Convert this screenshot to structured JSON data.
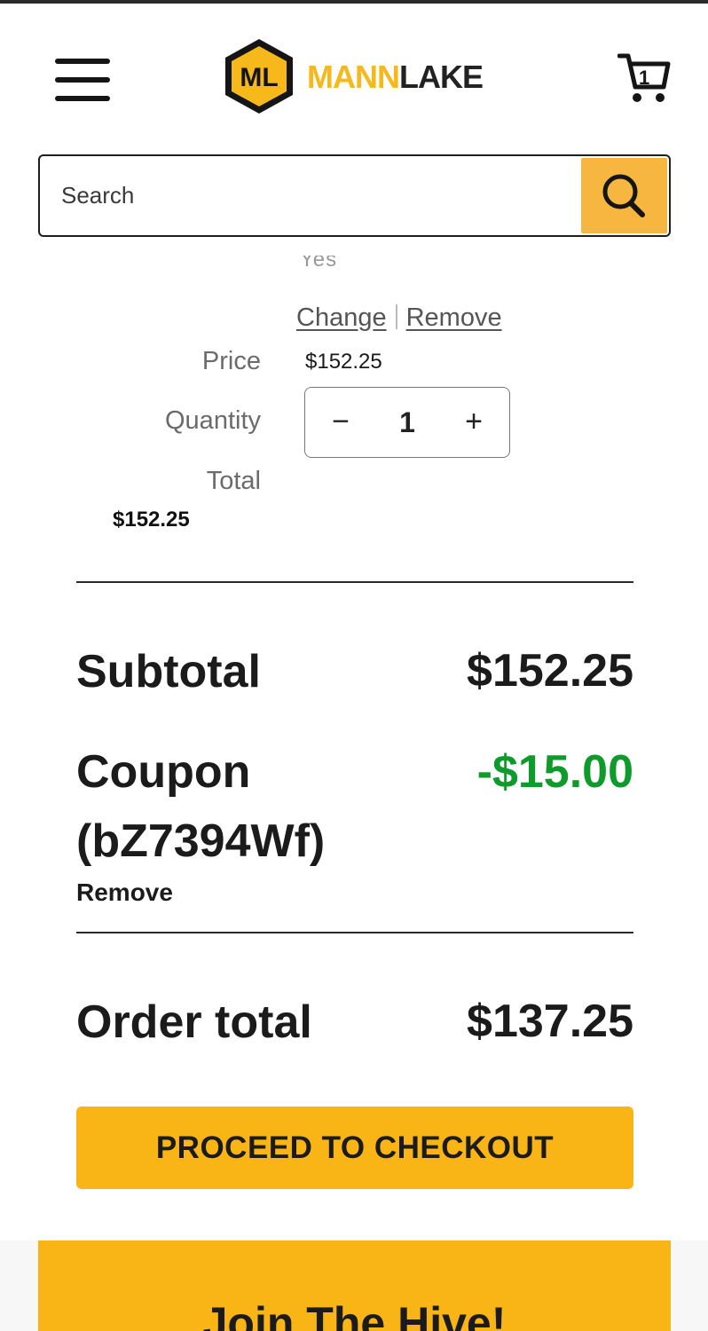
{
  "header": {
    "logo_mark_text": "ML",
    "logo_name_part1": "MANN",
    "logo_name_part2": "LAKE",
    "cart_count": "1"
  },
  "search": {
    "placeholder": "Search"
  },
  "cart_item": {
    "clipped_text": "Yes",
    "change_label": "Change",
    "remove_label": "Remove",
    "price_label": "Price",
    "price_value": "$152.25",
    "quantity_label": "Quantity",
    "quantity_value": "1",
    "decrement_symbol": "−",
    "increment_symbol": "+",
    "total_label": "Total",
    "total_value": "$152.25"
  },
  "summary": {
    "subtotal_label": "Subtotal",
    "subtotal_value": "$152.25",
    "coupon_label_line1": "Coupon",
    "coupon_label_line2": "(bZ7394Wf)",
    "coupon_value": "-$15.00",
    "coupon_remove_label": "Remove",
    "order_total_label": "Order total",
    "order_total_value": "$137.25"
  },
  "checkout": {
    "button_label": "PROCEED TO CHECKOUT"
  },
  "footer": {
    "join_title": "Join The Hive!"
  },
  "colors": {
    "brand_yellow": "#f8b515",
    "search_button": "#f6b640",
    "coupon_green": "#0f9a2c"
  }
}
